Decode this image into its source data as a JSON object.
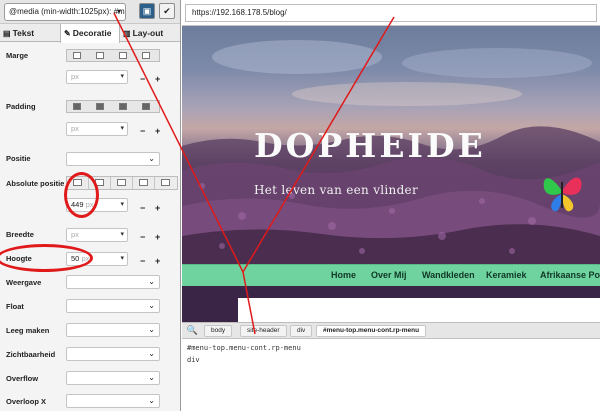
{
  "editor": {
    "media_query": "@media (min-width:1025px): #me",
    "save_icon": "save-icon",
    "check_icon": "check-icon",
    "tabs": [
      {
        "label": "Tekst",
        "icon": "text-icon"
      },
      {
        "label": "Decoratie",
        "icon": "brush-icon"
      },
      {
        "label": "Lay-out",
        "icon": "layout-icon"
      }
    ],
    "active_tab": "Decoratie",
    "properties": {
      "marge": "Marge",
      "padding": "Padding",
      "positie": "Positie",
      "absolute_positie": "Absolute positie",
      "breedte": "Breedte",
      "hoogte": "Hoogte",
      "weergave": "Weergave",
      "float": "Float",
      "leeg_maken": "Leeg maken",
      "zichtbaarheid": "Zichtbaarheid",
      "overflow": "Overflow",
      "overloop_x": "Overloop X"
    },
    "unit": "px",
    "plus": "+",
    "minus": "−",
    "abs_value": "449",
    "height_value": "50"
  },
  "browser": {
    "url": "https://192.168.178.5/blog/",
    "site_title": "DOPHEIDE",
    "tagline": "Het leven van een vlinder",
    "nav": [
      "Home",
      "Over Mij",
      "Wandkleden",
      "Keramiek",
      "Afrikaanse Po"
    ]
  },
  "devtools": {
    "breadcrumbs": [
      "body",
      "site-header",
      "div",
      "#menu-top.menu-cont.rp-menu"
    ],
    "code_line_1": "#menu-top.menu-cont.rp-menu",
    "code_line_2": "div"
  },
  "colors": {
    "annotation": "#e01a1a",
    "nav_bg": "#6fd3a0",
    "save_btn": "#2c5f8a",
    "banner_bg": "#3b2547"
  }
}
